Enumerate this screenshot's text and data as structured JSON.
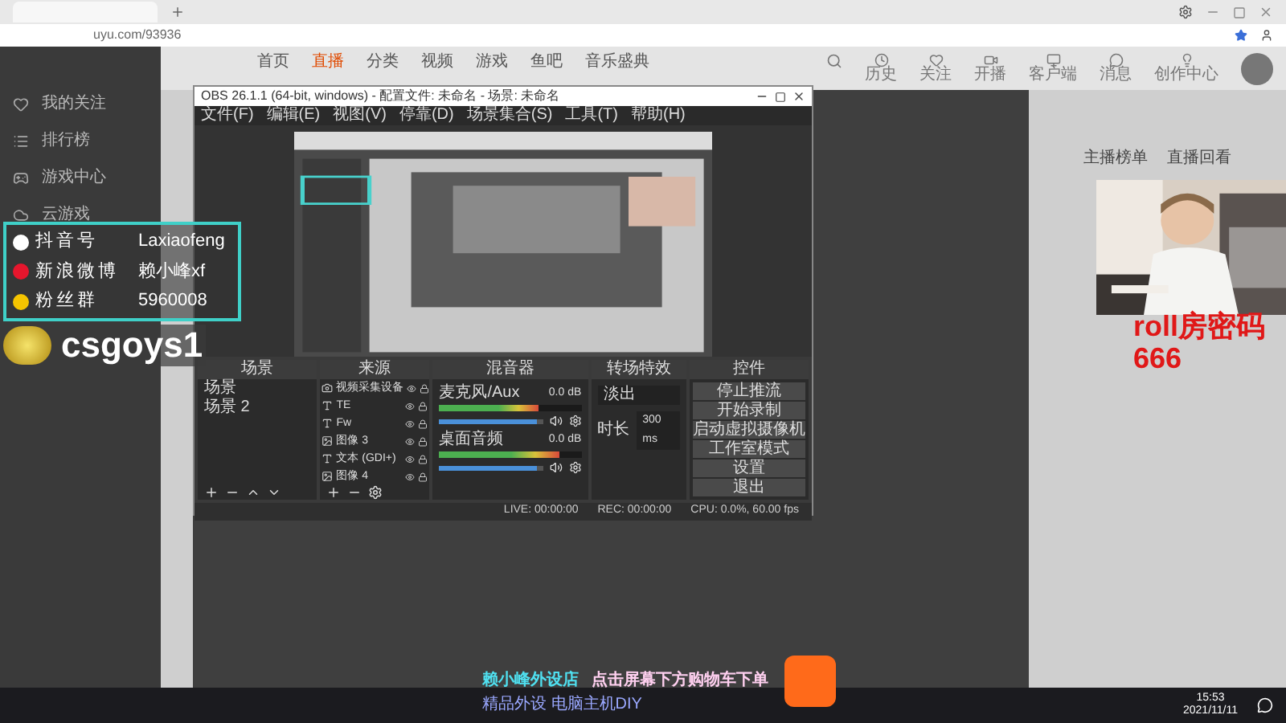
{
  "browser": {
    "address": "uyu.com/93936"
  },
  "site_nav": [
    {
      "label": "首页",
      "selected": false
    },
    {
      "label": "直播",
      "selected": true
    },
    {
      "label": "分类",
      "selected": false
    },
    {
      "label": "视频",
      "selected": false
    },
    {
      "label": "游戏",
      "selected": false
    },
    {
      "label": "鱼吧",
      "selected": false
    },
    {
      "label": "音乐盛典",
      "selected": false
    }
  ],
  "header_icons": [
    "历史",
    "关注",
    "开播",
    "客户端",
    "消息",
    "创作中心"
  ],
  "sidebar": {
    "items": [
      "我的关注",
      "排行榜",
      "游戏中心",
      "云游戏"
    ]
  },
  "obs": {
    "title": "OBS 26.1.1 (64-bit, windows) - 配置文件: 未命名 - 场景: 未命名",
    "menu": [
      "文件(F)",
      "编辑(E)",
      "视图(V)",
      "停靠(D)",
      "场景集合(S)",
      "工具(T)",
      "帮助(H)"
    ],
    "scenes": {
      "title": "场景",
      "items": [
        {
          "name": "场景",
          "selected": false
        },
        {
          "name": "场景 2",
          "selected": false
        }
      ]
    },
    "sources": {
      "title": "来源",
      "items": [
        {
          "name": "视频采集设备",
          "kind": "camera"
        },
        {
          "name": "TE",
          "kind": "text"
        },
        {
          "name": "Fw",
          "kind": "text"
        },
        {
          "name": "图像 3"
        },
        {
          "name": "文本 (GDI+)",
          "kind": "text"
        },
        {
          "name": "图像 4"
        }
      ]
    },
    "mixer": {
      "title": "混音器",
      "channels": [
        {
          "name": "麦克风/Aux",
          "reading": "0.0 dB",
          "meter": {
            "level": 0.7
          },
          "volume": {
            "level": 0.95
          }
        },
        {
          "name": "桌面音频",
          "reading": "0.0 dB",
          "meter": {
            "level": 0.85
          },
          "volume": {
            "level": 0.95
          }
        }
      ]
    },
    "transitions": {
      "title": "转场特效",
      "value": "淡出",
      "duration_label": "时长",
      "duration": "300 ms"
    },
    "controls": {
      "title": "控件",
      "buttons": [
        "停止推流",
        "开始录制",
        "启动虚拟摄像机",
        "工作室模式",
        "设置",
        "退出"
      ]
    },
    "status": {
      "live": "LIVE: 00:00:00",
      "rec": "REC: 00:00:00",
      "cpu": "CPU: 0.0%, 60.00 fps"
    }
  },
  "overlay": {
    "social": [
      {
        "kind": "tiktok",
        "platform": "抖音号",
        "value": "Laxiaofeng"
      },
      {
        "kind": "weibo",
        "platform": "新浪微博",
        "value": "赖小峰xf"
      },
      {
        "kind": "qq",
        "platform": "粉丝群",
        "value": "5960008"
      }
    ],
    "streamer_name": "csgoys1",
    "room_code": [
      "roll房密码",
      "666"
    ],
    "shop": [
      "赖小峰外设店",
      "点击屏幕下方购物车下单",
      "精品外设 电脑主机DIY"
    ]
  },
  "right_panel": {
    "tabs": [
      "主播榜单",
      "直播回看"
    ]
  },
  "taskbar": {
    "time": "15:53",
    "date": "2021/11/11"
  }
}
